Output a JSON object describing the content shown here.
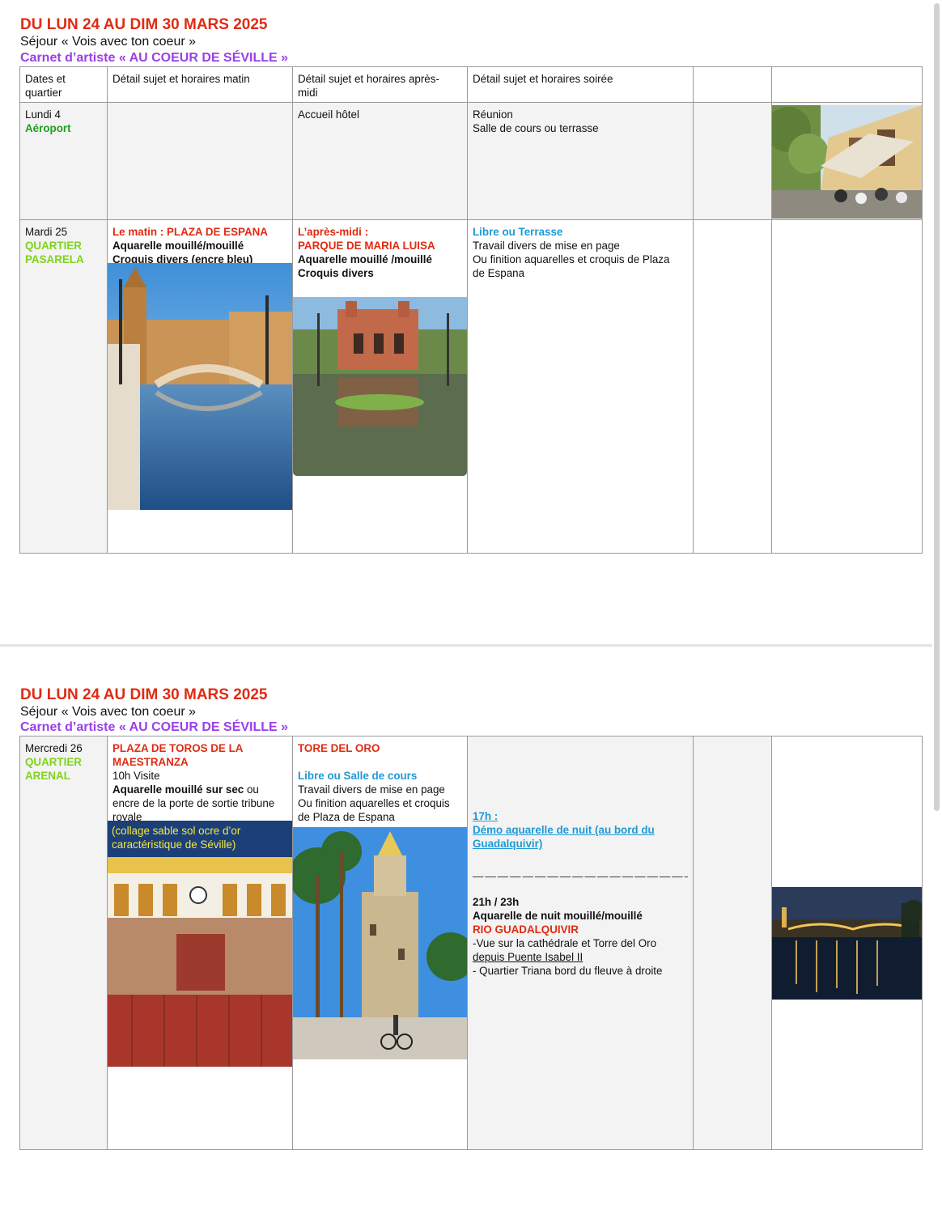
{
  "header": {
    "date_range": "DU LUN 24 AU DIM 30 MARS 2025",
    "sejour": "Séjour « Vois avec ton coeur »",
    "carnet": "Carnet d’artiste « AU COEUR DE SÉVILLE »"
  },
  "table_headers": {
    "col1_line1": "Dates et",
    "col1_line2": "quartier",
    "col2": "Détail sujet et horaires matin",
    "col3_line1": "Détail sujet et horaires après-",
    "col3_line2": "midi",
    "col4": "Détail sujet et horaires soirée"
  },
  "rows": {
    "lundi": {
      "day": "Lundi  4",
      "quartier": "Aéroport",
      "apres_midi": "Accueil hôtel",
      "soiree_line1": "Réunion",
      "soiree_line2": "Salle de cours ou terrasse"
    },
    "mardi": {
      "day": "Mardi 25",
      "quartier_line1": "QUARTIER",
      "quartier_line2": "PASARELA",
      "matin_prefix": "Le matin : ",
      "matin_place": "PLAZA DE ESPANA",
      "matin_line2": "Aquarelle mouillé/mouillé",
      "matin_line3": "Croquis divers (encre bleu)",
      "am_prefix": "L’après-midi :",
      "am_place": "PARQUE DE MARIA LUISA",
      "am_line3": "Aquarelle mouillé /mouillé",
      "am_line4": "Croquis divers",
      "soir_title": "Libre ou Terrasse",
      "soir_line2": "Travail divers de mise en page",
      "soir_line3": "Ou finition aquarelles et croquis de Plaza",
      "soir_line4": "de Espana"
    },
    "mercredi": {
      "day": "Mercredi 26",
      "quartier_line1": "QUARTIER",
      "quartier_line2": "ARENAL",
      "matin_title1": "PLAZA DE TOROS DE LA",
      "matin_title2": "MAESTRANZA",
      "matin_visit": "10h Visite",
      "matin_bold": "Aquarelle mouillé sur sec",
      "matin_rest1": " ou",
      "matin_rest2": "encre de la porte de sortie tribune",
      "matin_rest3": "royale",
      "matin_overlay1": "(collage sable sol ocre d’or",
      "matin_overlay2": "caractéristique de Séville)",
      "am_title": "TORE DEL ORO",
      "am_sub": "Libre ou Salle de cours",
      "am_line1": "Travail divers de mise en page",
      "am_line2": "Ou finition aquarelles et croquis",
      "am_line3": "de Plaza de Espana",
      "soir_time": "17h :",
      "soir_demo1": "Démo aquarelle de nuit (au bord du",
      "soir_demo2": "Guadalquivir)",
      "soir_dash": "————————————————————",
      "soir_time2": "21h / 23h",
      "soir_night": "Aquarelle de nuit mouillé/mouillé",
      "soir_river": "RIO  GUADALQUIVIR",
      "soir_view1": "-Vue sur la cathédrale et Torre del Oro",
      "soir_view2": "depuis Puente Isabel II ",
      "soir_view3": "- Quartier Triana bord du fleuve à droite"
    }
  },
  "colors": {
    "date_red": "#e02b12",
    "carnet_purple": "#9b3fe8",
    "green": "#1f9e1f",
    "lime": "#7ed31c",
    "blue": "#1e9ad6"
  }
}
